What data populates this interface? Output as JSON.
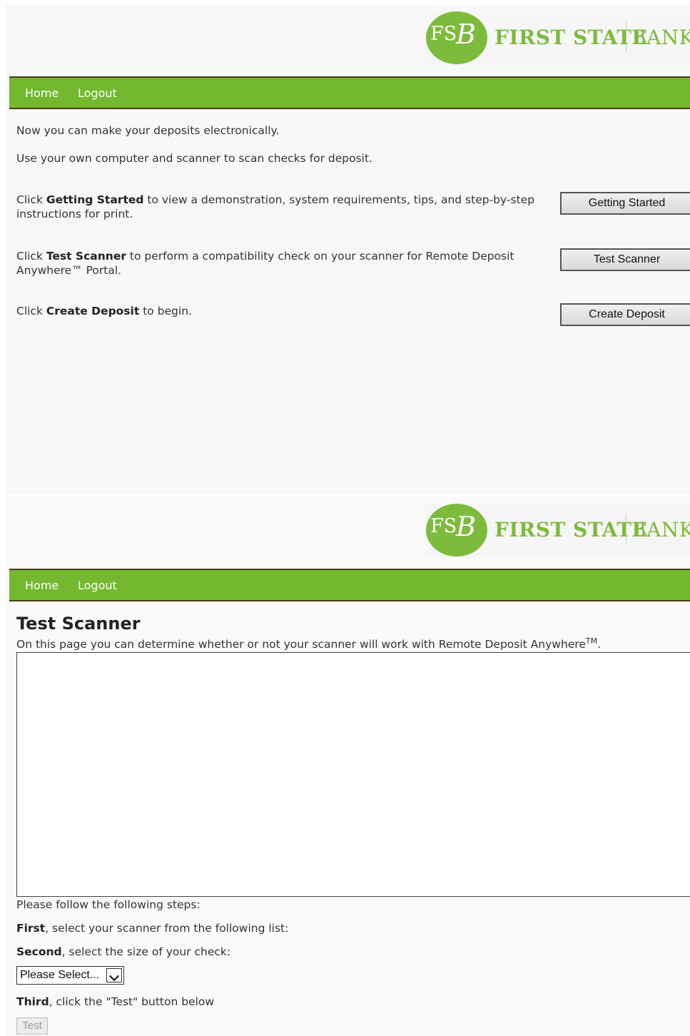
{
  "brand": {
    "fs": "FS",
    "b": "B",
    "first_state": "FIRST STATE",
    "bank": "BANK",
    "green": "#7dbb3c"
  },
  "nav": {
    "home": "Home",
    "logout": "Logout",
    "bar_color": "#73b82e"
  },
  "landing": {
    "line1": "Now you can make your deposits electronically.",
    "line2": "Use your own computer and scanner to scan checks for deposit.",
    "getting_started": {
      "pre": "Click ",
      "bold": "Getting Started",
      "post": " to view a demonstration, system requirements, tips, and step-by-step instructions for print.",
      "button": "Getting Started"
    },
    "test_scanner": {
      "pre": "Click ",
      "bold": "Test Scanner",
      "post": " to perform a compatibility check on your scanner for Remote Deposit Anywhere™ Portal.",
      "button": "Test Scanner"
    },
    "create_deposit": {
      "pre": "Click ",
      "bold": "Create Deposit",
      "post": " to begin.",
      "button": "Create Deposit"
    }
  },
  "test_page": {
    "title": "Test Scanner",
    "subtitle": "On this page you can determine whether or not your scanner will work with Remote Deposit Anywhere",
    "tm": "TM",
    "period": ".",
    "steps_intro": "Please follow the following steps:",
    "first_bold": "First",
    "first_text": ", select your scanner from the following list:",
    "second_bold": "Second",
    "second_text": ", select the size of your check:",
    "select_value": "Please Select...",
    "third_bold": "Third",
    "third_text": ", click the \"Test\" button below",
    "test_button": "Test"
  }
}
